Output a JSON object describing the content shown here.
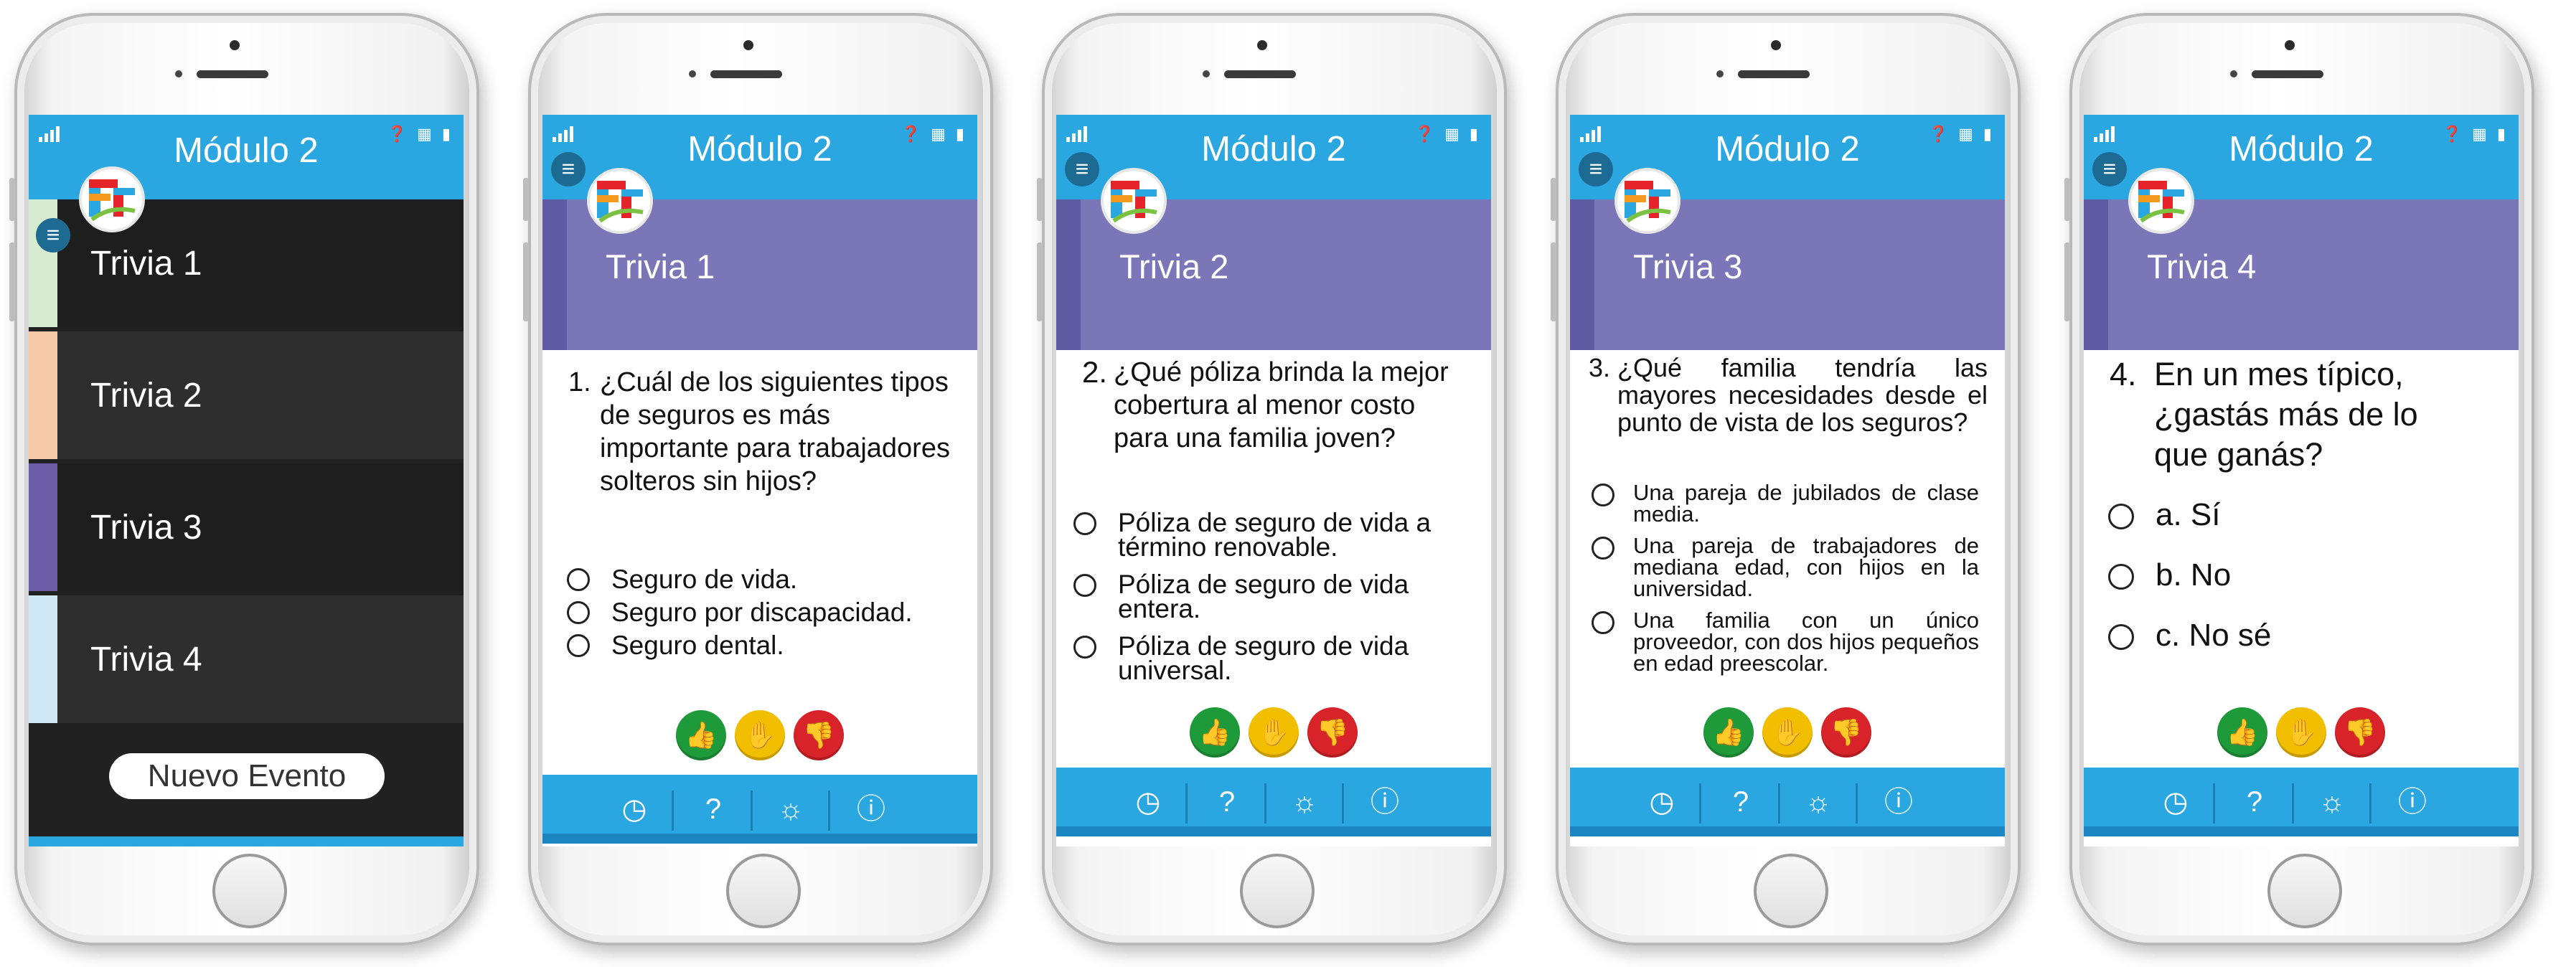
{
  "app": {
    "module_title": "Módulo 2",
    "status_icons": "❓ ▦ ▮",
    "colors": {
      "accent": "#2aa7e0",
      "header": "#7b76b7",
      "menu_bg": "#212121",
      "like": "#1f9a3a",
      "neutral": "#f2be00",
      "dislike": "#d8232a"
    }
  },
  "menu": {
    "items": [
      {
        "label": "Trivia 1",
        "stripe_color": "#d6ebcf"
      },
      {
        "label": "Trivia 2",
        "stripe_color": "#f6c9a8"
      },
      {
        "label": "Trivia 3",
        "stripe_color": "#6a5ca6"
      },
      {
        "label": "Trivia 4",
        "stripe_color": "#cfe7f5"
      }
    ],
    "new_event_label": "Nuevo Evento"
  },
  "trivias": [
    {
      "header": "Trivia 1",
      "number": "1.",
      "question": "¿Cuál de los siguientes tipos de seguros es más importante para trabajadores solteros sin hijos?",
      "options": [
        "Seguro de vida.",
        "Seguro por discapacidad.",
        "Seguro dental."
      ]
    },
    {
      "header": "Trivia 2",
      "number": "2.",
      "question": "¿Qué póliza brinda la mejor cobertura al menor costo para una familia joven?",
      "options": [
        "Póliza de seguro de vida a término renovable.",
        "Póliza de seguro de vida entera.",
        "Póliza de seguro de vida universal."
      ]
    },
    {
      "header": "Trivia 3",
      "number": "3.",
      "question": "¿Qué familia tendría las mayores necesidades desde el punto de vista de los seguros?",
      "options": [
        "Una pareja de jubilados de clase media.",
        "Una pareja de trabajadores de mediana edad, con hijos en la universidad.",
        "Una familia con un único proveedor, con dos hijos pequeños en edad preescolar."
      ]
    },
    {
      "header": "Trivia 4",
      "number": "4.",
      "question": "En un mes típico, ¿gastás más de lo que ganás?",
      "options": [
        "a. Sí",
        "b. No",
        "c. No sé"
      ]
    }
  ],
  "icons": {
    "menu": "menu-icon",
    "logo": "logo-icon",
    "like": "thumbs-up-icon",
    "neutral": "hand-neutral-icon",
    "dislike": "thumbs-down-icon",
    "footer": [
      "timer-icon",
      "help-icon",
      "idea-icon",
      "info-icon"
    ]
  }
}
